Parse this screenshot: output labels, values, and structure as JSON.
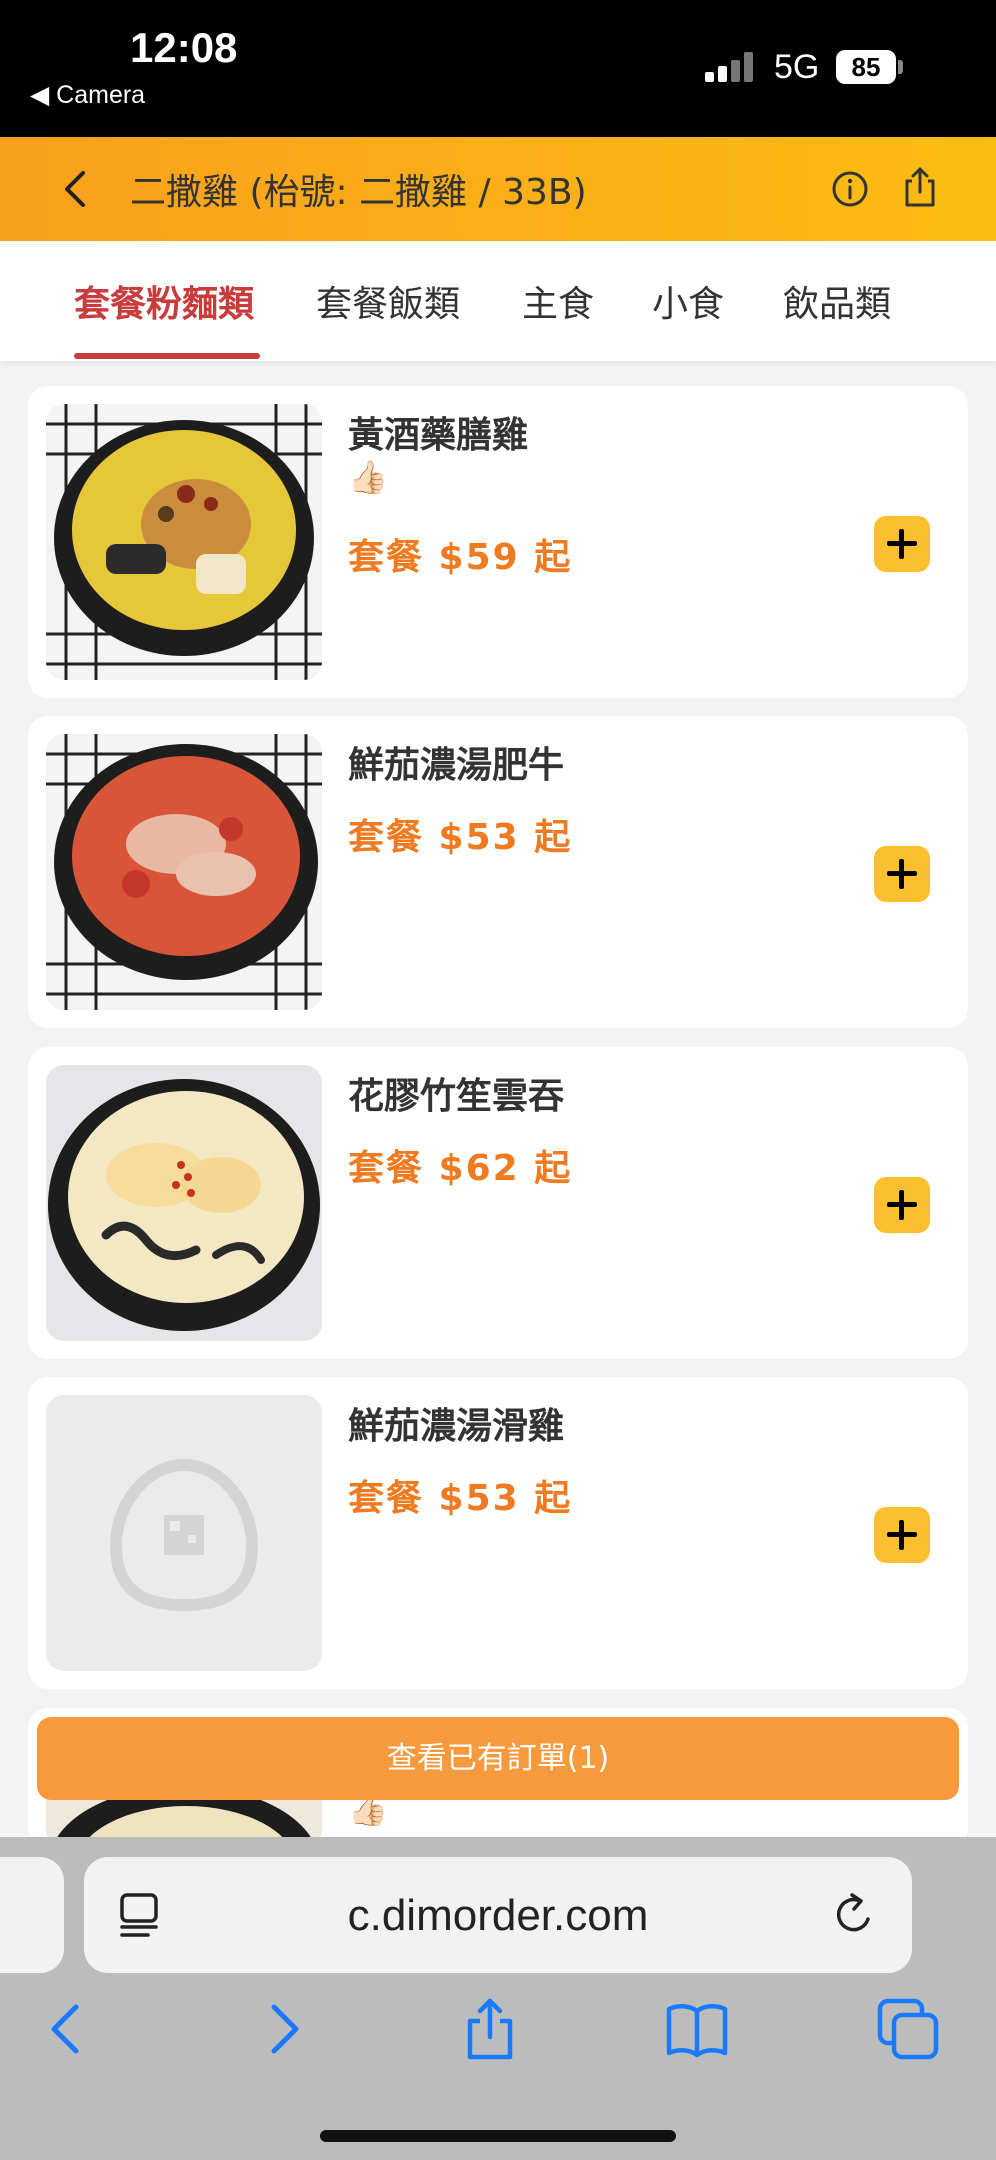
{
  "status_bar": {
    "time": "12:08",
    "back_app": "◀ Camera",
    "network": "5G",
    "battery": "85"
  },
  "header": {
    "title": "二撒雞 (枱號: 二撒雞 / 33B)"
  },
  "tabs": [
    {
      "label": "套餐粉麵類",
      "active": true
    },
    {
      "label": "套餐飯類",
      "active": false
    },
    {
      "label": "主食",
      "active": false
    },
    {
      "label": "小食",
      "active": false
    },
    {
      "label": "飲品類",
      "active": false
    }
  ],
  "items": [
    {
      "name": "黃酒藥膳雞",
      "badge": "👍🏻",
      "price": "套餐 $59 起"
    },
    {
      "name": "鮮茄濃湯肥牛",
      "price": "套餐 $53 起"
    },
    {
      "name": "花膠竹笙雲吞",
      "price": "套餐 $62 起"
    },
    {
      "name": "鮮茄濃湯滑雞",
      "price": "套餐 $53 起"
    }
  ],
  "partial_item_badge": "👍🏻",
  "orders_button": "查看已有訂單(1)",
  "browser": {
    "url": "c.dimorder.com"
  },
  "colors": {
    "header_start": "#f9a01c",
    "header_end": "#fbbd12",
    "active_tab": "#c83c3c",
    "price": "#f07a20",
    "add_button": "#fcc02e",
    "orders_button": "#f79a3e",
    "ios_blue": "#1a7aff"
  }
}
